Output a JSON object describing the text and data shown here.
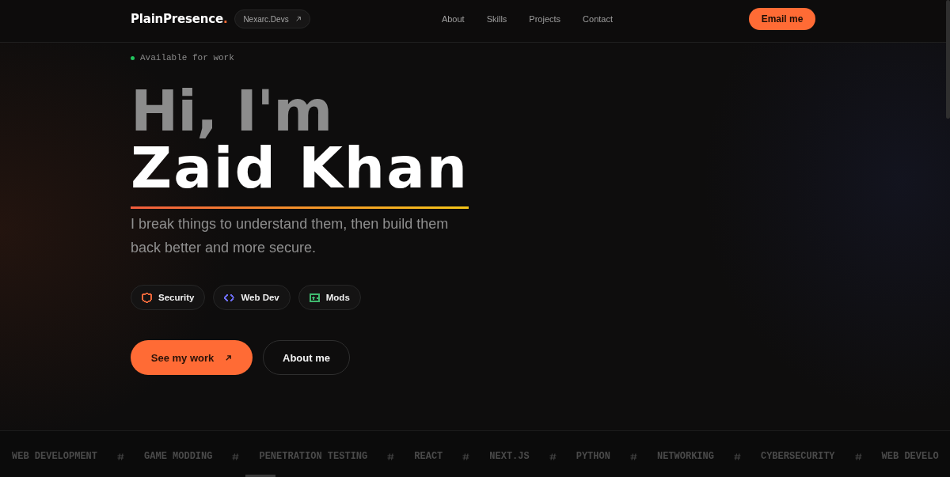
{
  "header": {
    "logo": {
      "text": "PlainPresence",
      "accent": "."
    },
    "badge_link": {
      "label": "Nexarc.Devs"
    },
    "nav": [
      "About",
      "Skills",
      "Projects",
      "Contact"
    ],
    "cta": {
      "label": "Email me"
    }
  },
  "hero": {
    "status": "Available for work",
    "greeting": "Hi, I'm",
    "name": "Zaid Khan",
    "tagline": "I break things to understand them, then build them back better and more secure.",
    "chips": [
      {
        "label": "Security",
        "kind": "shield",
        "color": "#f0673a"
      },
      {
        "label": "Web Dev",
        "kind": "code",
        "color": "#6b6bf0"
      },
      {
        "label": "Mods",
        "kind": "gamepad",
        "color": "#3fb86e"
      }
    ],
    "buttons": [
      {
        "label": "See my work",
        "kind": "primary"
      },
      {
        "label": "About me",
        "kind": "secondary"
      }
    ]
  },
  "marquee": [
    "WEB DEVELOPMENT",
    "GAME MODDING",
    "PENETRATION TESTING",
    "REACT",
    "NEXT.JS",
    "PYTHON",
    "NETWORKING",
    "CYBERSECURITY",
    "WEB DEVELO"
  ]
}
